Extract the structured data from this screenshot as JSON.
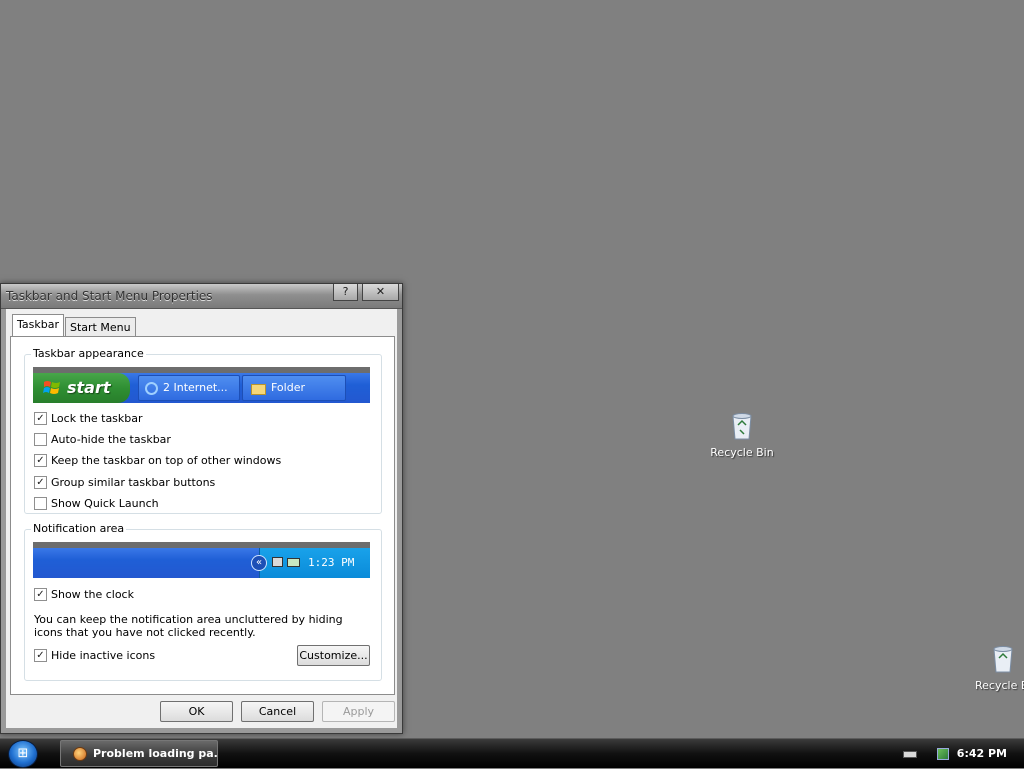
{
  "desktop": {
    "icons": [
      {
        "label": "Recycle Bin"
      },
      {
        "label": "Recycle Bi"
      }
    ]
  },
  "dialog": {
    "title": "Taskbar and Start Menu Properties",
    "help_glyph": "?",
    "close_glyph": "✕",
    "tabs": [
      {
        "label": "Taskbar",
        "active": true
      },
      {
        "label": "Start Menu",
        "active": false
      }
    ],
    "appearance": {
      "legend": "Taskbar appearance",
      "preview": {
        "start_label": "start",
        "button1_label": "2 Internet...",
        "button2_label": "Folder"
      },
      "options": [
        {
          "label": "Lock the taskbar",
          "checked": true
        },
        {
          "label": "Auto-hide the taskbar",
          "checked": false
        },
        {
          "label": "Keep the taskbar on top of other windows",
          "checked": true
        },
        {
          "label": "Group similar taskbar buttons",
          "checked": true
        },
        {
          "label": "Show Quick Launch",
          "checked": false
        }
      ]
    },
    "notification": {
      "legend": "Notification area",
      "preview": {
        "time": "1:23 PM",
        "expand_glyph": "«"
      },
      "show_clock": {
        "label": "Show the clock",
        "checked": true
      },
      "description": "You can keep the notification area uncluttered by hiding icons that you have not clicked recently.",
      "hide_inactive": {
        "label": "Hide inactive icons",
        "checked": true
      },
      "customize_label": "Customize..."
    },
    "buttons": {
      "ok": "OK",
      "cancel": "Cancel",
      "apply": "Apply"
    }
  },
  "taskbar": {
    "start_glyph": "⊞",
    "window_button": {
      "label": "Problem loading pa..."
    },
    "clock": "6:42 PM"
  },
  "check_glyph": "✓",
  "colors": {
    "desktop": "#808080",
    "xp_blue": "#2358d0",
    "xp_green": "#2f8f33",
    "tray_blue": "#0a8bd9"
  }
}
